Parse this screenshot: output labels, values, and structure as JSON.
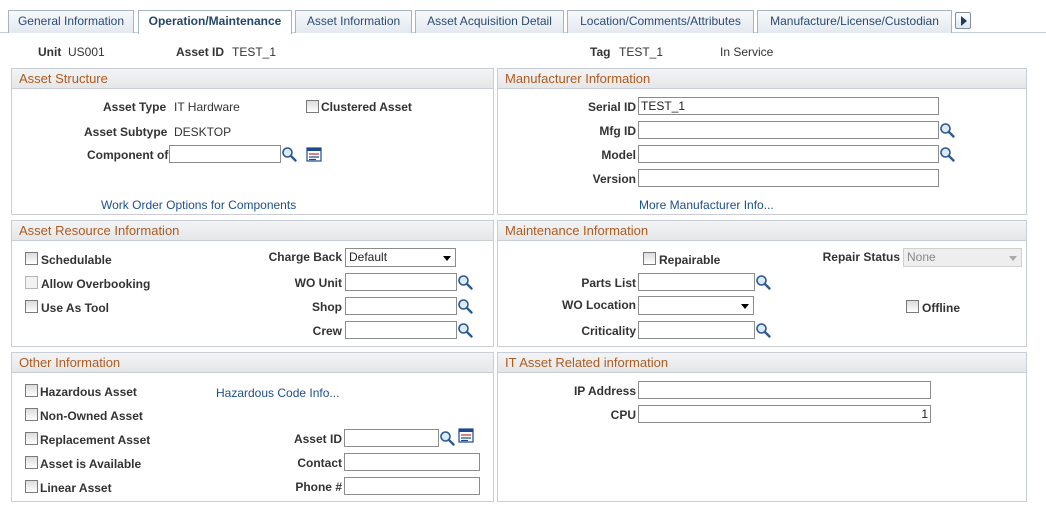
{
  "tabs": [
    {
      "label": "General Information"
    },
    {
      "label": "Operation/Maintenance"
    },
    {
      "label": "Asset Information"
    },
    {
      "label": "Asset Acquisition Detail"
    },
    {
      "label": "Location/Comments/Attributes"
    },
    {
      "label": "Manufacture/License/Custodian"
    }
  ],
  "header": {
    "unit_label": "Unit",
    "unit_value": "US001",
    "asset_id_label": "Asset ID",
    "asset_id_value": "TEST_1",
    "tag_label": "Tag",
    "tag_value": "TEST_1",
    "status": "In Service"
  },
  "asset_structure": {
    "title": "Asset Structure",
    "asset_type_label": "Asset Type",
    "asset_type_value": "IT Hardware",
    "clustered_label": "Clustered Asset",
    "asset_subtype_label": "Asset Subtype",
    "asset_subtype_value": "DESKTOP",
    "component_label": "Component of",
    "component_value": "",
    "work_order_link": "Work Order Options for Components"
  },
  "manufacturer": {
    "title": "Manufacturer Information",
    "serial_label": "Serial ID",
    "serial_value": "TEST_1",
    "mfg_label": "Mfg ID",
    "mfg_value": "",
    "model_label": "Model",
    "model_value": "",
    "version_label": "Version",
    "version_value": "",
    "more_link": "More Manufacturer Info..."
  },
  "resource": {
    "title": "Asset Resource Information",
    "schedulable_label": "Schedulable",
    "overbooking_label": "Allow Overbooking",
    "use_as_tool_label": "Use As Tool",
    "charge_back_label": "Charge Back",
    "charge_back_value": "Default",
    "wo_unit_label": "WO Unit",
    "wo_unit_value": "",
    "shop_label": "Shop",
    "shop_value": "",
    "crew_label": "Crew",
    "crew_value": ""
  },
  "maintenance": {
    "title": "Maintenance Information",
    "repairable_label": "Repairable",
    "repair_status_label": "Repair Status",
    "repair_status_value": "None",
    "parts_list_label": "Parts List",
    "parts_list_value": "",
    "wo_location_label": "WO Location",
    "wo_location_value": "",
    "offline_label": "Offline",
    "criticality_label": "Criticality",
    "criticality_value": ""
  },
  "other": {
    "title": "Other Information",
    "hazardous_label": "Hazardous Asset",
    "hazardous_link": "Hazardous Code Info...",
    "non_owned_label": "Non-Owned Asset",
    "replacement_label": "Replacement Asset",
    "available_label": "Asset is Available",
    "linear_label": "Linear Asset",
    "asset_id_label": "Asset ID",
    "asset_id_value": "",
    "contact_label": "Contact",
    "contact_value": "",
    "phone_label": "Phone #",
    "phone_value": ""
  },
  "it_asset": {
    "title": "IT Asset Related information",
    "ip_label": "IP Address",
    "ip_value": "",
    "cpu_label": "CPU",
    "cpu_value": "1"
  },
  "icons": {
    "lookup": "magnifier-icon",
    "detail": "detail-page-icon",
    "next_tab": "next-tab-arrow-icon"
  }
}
